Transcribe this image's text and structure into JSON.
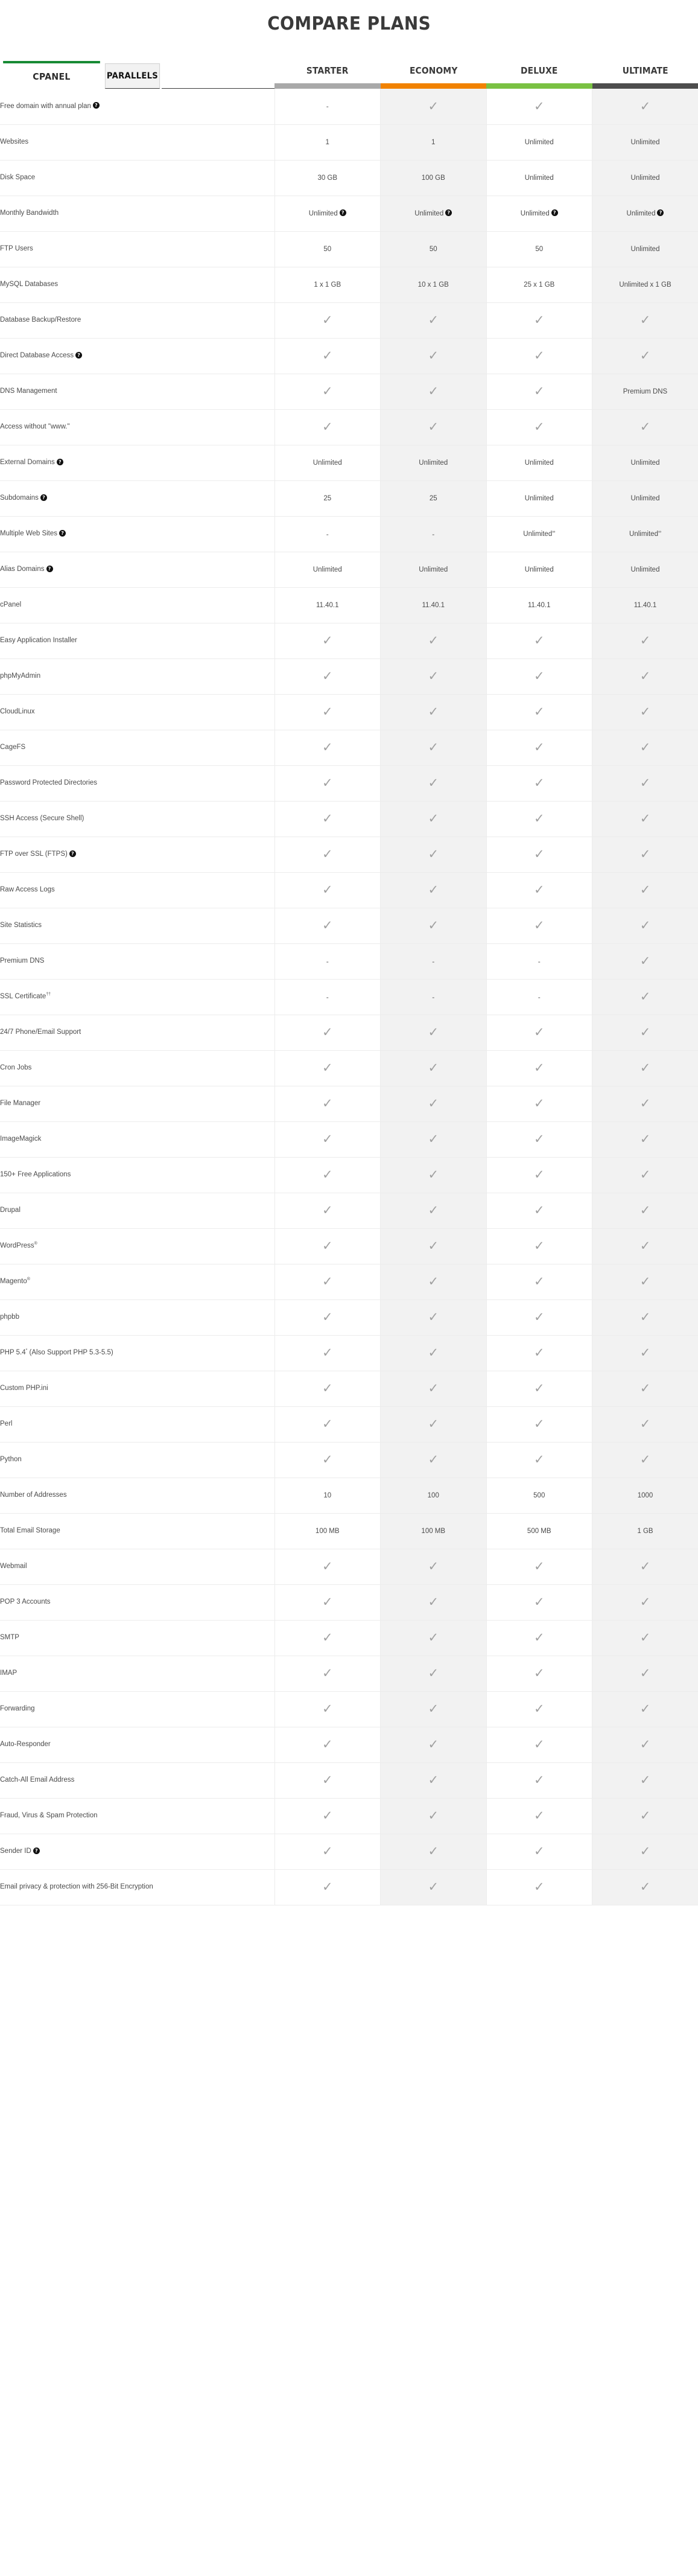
{
  "page_title": "COMPARE PLANS",
  "tabs": [
    {
      "label": "CPANEL",
      "active": true
    },
    {
      "label": "PARALLELS",
      "active": false
    }
  ],
  "colors": {
    "starter_bar": "#a9a9a9",
    "economy_bar": "#f18200",
    "deluxe_bar": "#7ac143",
    "ultimate_bar": "#4d4d4d",
    "active_tab_accent": "#178a34",
    "check": "#a0a0a0",
    "alt_column": "#f2f2f2"
  },
  "plans": [
    {
      "name": "STARTER",
      "bar_color": "#a9a9a9"
    },
    {
      "name": "ECONOMY",
      "bar_color": "#f18200"
    },
    {
      "name": "DELUXE",
      "bar_color": "#7ac143"
    },
    {
      "name": "ULTIMATE",
      "bar_color": "#4d4d4d"
    }
  ],
  "rows": [
    {
      "feature": "Free domain with annual plan",
      "help": true,
      "values": [
        "-",
        "check",
        "check",
        "check"
      ]
    },
    {
      "feature": "Websites",
      "help": false,
      "values": [
        "1",
        "1",
        "Unlimited",
        "Unlimited"
      ]
    },
    {
      "feature": "Disk Space",
      "help": false,
      "values": [
        "30 GB",
        "100 GB",
        "Unlimited",
        "Unlimited"
      ]
    },
    {
      "feature": "Monthly Bandwidth",
      "help": false,
      "values": [
        "Unlimited?",
        "Unlimited?",
        "Unlimited?",
        "Unlimited?"
      ]
    },
    {
      "feature": "FTP Users",
      "help": false,
      "values": [
        "50",
        "50",
        "50",
        "Unlimited"
      ]
    },
    {
      "feature": "MySQL Databases",
      "help": false,
      "values": [
        "1 x 1 GB",
        "10 x 1 GB",
        "25 x 1 GB",
        "Unlimited x 1 GB"
      ]
    },
    {
      "feature": "Database Backup/Restore",
      "help": false,
      "values": [
        "check",
        "check",
        "check",
        "check"
      ]
    },
    {
      "feature": "Direct Database Access",
      "help": true,
      "values": [
        "check",
        "check",
        "check",
        "check"
      ]
    },
    {
      "feature": "DNS Management",
      "help": false,
      "values": [
        "check",
        "check",
        "check",
        "Premium DNS"
      ]
    },
    {
      "feature": "Access without \"www.\"",
      "help": false,
      "values": [
        "check",
        "check",
        "check",
        "check"
      ]
    },
    {
      "feature": "External Domains",
      "help": true,
      "values": [
        "Unlimited",
        "Unlimited",
        "Unlimited",
        "Unlimited"
      ]
    },
    {
      "feature": "Subdomains",
      "help": true,
      "values": [
        "25",
        "25",
        "Unlimited",
        "Unlimited"
      ]
    },
    {
      "feature": "Multiple Web Sites",
      "help": true,
      "values": [
        "-",
        "-",
        "Unlimited^",
        "Unlimited^"
      ]
    },
    {
      "feature": "Alias Domains",
      "help": true,
      "values": [
        "Unlimited",
        "Unlimited",
        "Unlimited",
        "Unlimited"
      ]
    },
    {
      "feature": "cPanel",
      "help": false,
      "values": [
        "11.40.1",
        "11.40.1",
        "11.40.1",
        "11.40.1"
      ]
    },
    {
      "feature": "Easy Application Installer",
      "help": false,
      "values": [
        "check",
        "check",
        "check",
        "check"
      ]
    },
    {
      "feature": "phpMyAdmin",
      "help": false,
      "values": [
        "check",
        "check",
        "check",
        "check"
      ]
    },
    {
      "feature": "CloudLinux",
      "help": false,
      "values": [
        "check",
        "check",
        "check",
        "check"
      ]
    },
    {
      "feature": "CageFS",
      "help": false,
      "values": [
        "check",
        "check",
        "check",
        "check"
      ]
    },
    {
      "feature": "Password Protected Directories",
      "help": false,
      "values": [
        "check",
        "check",
        "check",
        "check"
      ]
    },
    {
      "feature": "SSH Access (Secure Shell)",
      "help": false,
      "values": [
        "check",
        "check",
        "check",
        "check"
      ]
    },
    {
      "feature": "FTP over SSL (FTPS)",
      "help": true,
      "values": [
        "check",
        "check",
        "check",
        "check"
      ]
    },
    {
      "feature": "Raw Access Logs",
      "help": false,
      "values": [
        "check",
        "check",
        "check",
        "check"
      ]
    },
    {
      "feature": "Site Statistics",
      "help": false,
      "values": [
        "check",
        "check",
        "check",
        "check"
      ]
    },
    {
      "feature": "Premium DNS",
      "help": false,
      "values": [
        "-",
        "-",
        "-",
        "check"
      ]
    },
    {
      "feature": "SSL Certificate††",
      "help": false,
      "values": [
        "-",
        "-",
        "-",
        "check"
      ]
    },
    {
      "feature": "24/7 Phone/Email Support",
      "help": false,
      "values": [
        "check",
        "check",
        "check",
        "check"
      ]
    },
    {
      "feature": "Cron Jobs",
      "help": false,
      "values": [
        "check",
        "check",
        "check",
        "check"
      ]
    },
    {
      "feature": "File Manager",
      "help": false,
      "values": [
        "check",
        "check",
        "check",
        "check"
      ]
    },
    {
      "feature": "ImageMagick",
      "help": false,
      "values": [
        "check",
        "check",
        "check",
        "check"
      ]
    },
    {
      "feature": "150+ Free Applications",
      "help": false,
      "values": [
        "check",
        "check",
        "check",
        "check"
      ]
    },
    {
      "feature": "Drupal",
      "help": false,
      "values": [
        "check",
        "check",
        "check",
        "check"
      ]
    },
    {
      "feature": "WordPress®",
      "help": false,
      "values": [
        "check",
        "check",
        "check",
        "check"
      ]
    },
    {
      "feature": "Magento®",
      "help": false,
      "values": [
        "check",
        "check",
        "check",
        "check"
      ]
    },
    {
      "feature": "phpbb",
      "help": false,
      "values": [
        "check",
        "check",
        "check",
        "check"
      ]
    },
    {
      "feature": "PHP 5.4* (Also Support PHP 5.3-5.5)",
      "help": false,
      "values": [
        "check",
        "check",
        "check",
        "check"
      ]
    },
    {
      "feature": "Custom PHP.ini",
      "help": false,
      "values": [
        "check",
        "check",
        "check",
        "check"
      ]
    },
    {
      "feature": "Perl",
      "help": false,
      "values": [
        "check",
        "check",
        "check",
        "check"
      ]
    },
    {
      "feature": "Python",
      "help": false,
      "values": [
        "check",
        "check",
        "check",
        "check"
      ]
    },
    {
      "feature": "Number of Addresses",
      "help": false,
      "values": [
        "10",
        "100",
        "500",
        "1000"
      ]
    },
    {
      "feature": "Total Email Storage",
      "help": false,
      "values": [
        "100 MB",
        "100 MB",
        "500 MB",
        "1 GB"
      ]
    },
    {
      "feature": "Webmail",
      "help": false,
      "values": [
        "check",
        "check",
        "check",
        "check"
      ]
    },
    {
      "feature": "POP 3 Accounts",
      "help": false,
      "values": [
        "check",
        "check",
        "check",
        "check"
      ]
    },
    {
      "feature": "SMTP",
      "help": false,
      "values": [
        "check",
        "check",
        "check",
        "check"
      ]
    },
    {
      "feature": "IMAP",
      "help": false,
      "values": [
        "check",
        "check",
        "check",
        "check"
      ]
    },
    {
      "feature": "Forwarding",
      "help": false,
      "values": [
        "check",
        "check",
        "check",
        "check"
      ]
    },
    {
      "feature": "Auto-Responder",
      "help": false,
      "values": [
        "check",
        "check",
        "check",
        "check"
      ]
    },
    {
      "feature": "Catch-All Email Address",
      "help": false,
      "values": [
        "check",
        "check",
        "check",
        "check"
      ]
    },
    {
      "feature": "Fraud, Virus & Spam Protection",
      "help": false,
      "values": [
        "check",
        "check",
        "check",
        "check"
      ]
    },
    {
      "feature": "Sender ID",
      "help": true,
      "values": [
        "check",
        "check",
        "check",
        "check"
      ]
    },
    {
      "feature": "Email privacy & protection with 256-Bit Encryption",
      "help": false,
      "values": [
        "check",
        "check",
        "check",
        "check"
      ]
    }
  ],
  "icons": {
    "help": "?",
    "check_glyph": "✓"
  }
}
